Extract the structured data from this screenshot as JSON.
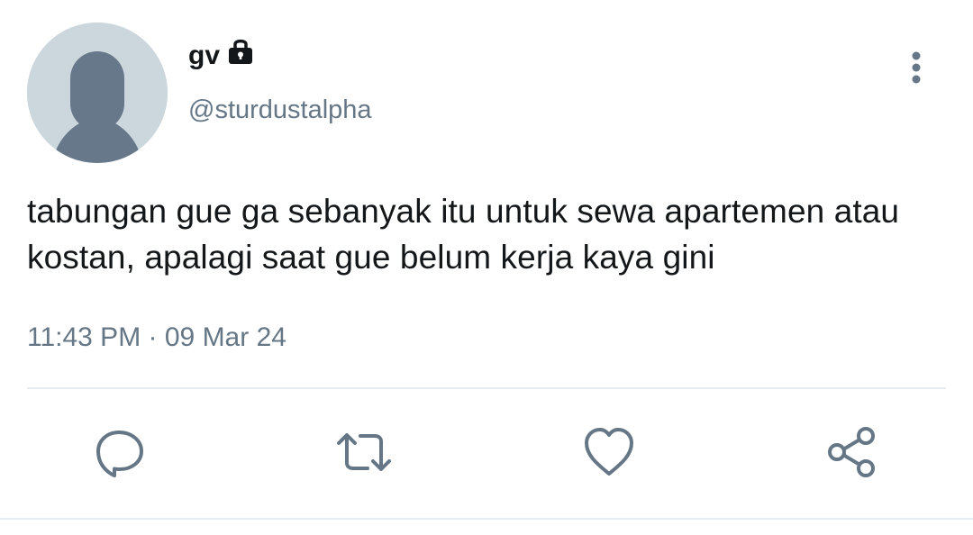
{
  "user": {
    "display_name": "gv",
    "handle": "@sturdustalpha",
    "protected_icon": "lock-icon"
  },
  "tweet": {
    "text": "tabungan gue ga sebanyak itu untuk sewa apartemen atau\nkostan, apalagi saat gue belum kerja kaya gini",
    "time": "11:43 PM",
    "separator": " · ",
    "date": "09 Mar 24"
  },
  "actions": [
    {
      "name": "reply",
      "icon": "comment-icon"
    },
    {
      "name": "retweet",
      "icon": "retweet-icon"
    },
    {
      "name": "like",
      "icon": "heart-icon"
    },
    {
      "name": "share",
      "icon": "share-icon"
    }
  ],
  "colors": {
    "text_primary": "#14171a",
    "text_secondary": "#657786",
    "icon": "#657786",
    "avatar_bg": "#ccd6dd",
    "avatar_fg": "#66788a",
    "divider": "#e6ecf0"
  }
}
